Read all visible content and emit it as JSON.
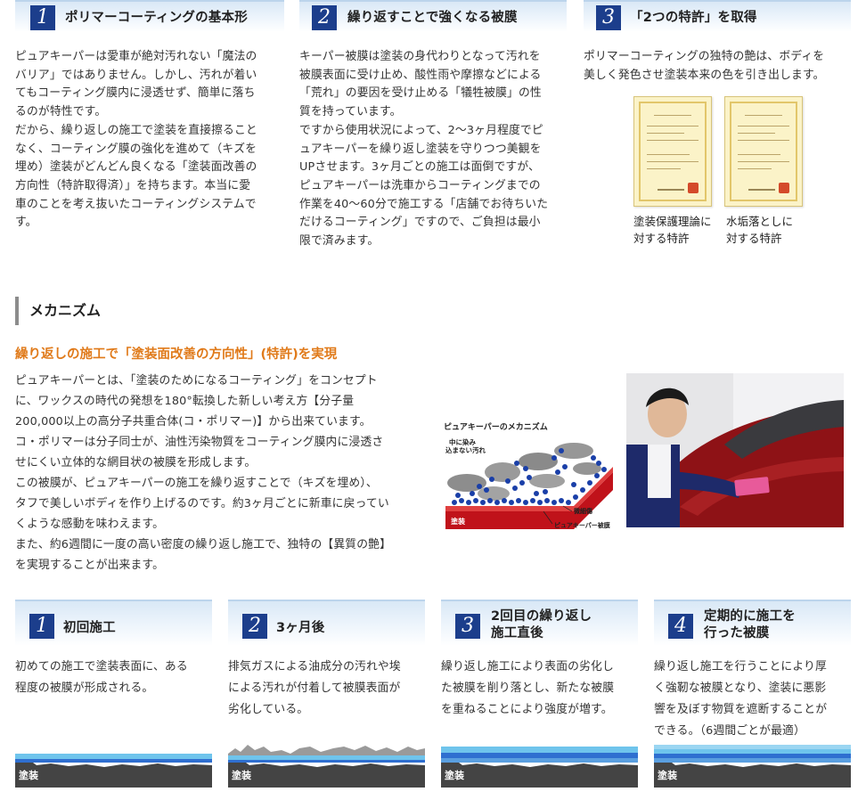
{
  "top_sections": [
    {
      "number": "1",
      "title": "ポリマーコーティングの基本形",
      "lines": [
        "ピュアキーパーは愛車が絶対汚れない「魔法の",
        "バリア」ではありません。しかし、汚れが着い",
        "てもコーティング膜内に浸透せず、簡単に落ち",
        "るのが特性です。",
        "だから、繰り返しの施工で塗装を直接擦ること",
        "なく、コーティング膜の強化を進めて（キズを",
        "埋め）塗装がどんどん良くなる「塗装面改善の",
        "方向性（特許取得済）」を持ちます。本当に愛",
        "車のことを考え抜いたコーティングシステムで",
        "す。"
      ]
    },
    {
      "number": "2",
      "title": "繰り返すことで強くなる被膜",
      "lines": [
        "キーパー被膜は塗装の身代わりとなって汚れを",
        "被膜表面に受け止め、酸性雨や摩擦などによる",
        "「荒れ」の要因を受け止める「犠牲被膜」の性",
        "質を持っています。",
        "ですから使用状況によって、2〜3ヶ月程度でピ",
        "ュアキーパーを繰り返し塗装を守りつつ美観を",
        "UPさせます。3ヶ月ごとの施工は面倒ですが、",
        "ピュアキーパーは洗車からコーティングまでの",
        "作業を40〜60分で施工する「店舗でお待ちいた",
        "だけるコーティング」ですので、ご負担は最小",
        "限で済みます。"
      ]
    },
    {
      "number": "3",
      "title": "「2つの特許」を取得",
      "lines": [
        "ポリマーコーティングの独特の艶は、ボディを",
        "美しく発色させ塗装本来の色を引き出します。"
      ],
      "certificates": [
        {
          "caption_1": "塗装保護理論に",
          "caption_2": "対する特許"
        },
        {
          "caption_1": "水垢落としに",
          "caption_2": "対する特許"
        }
      ]
    }
  ],
  "mechanism": {
    "heading": "メカニズム",
    "subheading": "繰り返しの施工で「塗装面改善の方向性」(特許)を実現",
    "lines": [
      "ピュアキーパーとは、「塗装のためになるコーティング」をコンセプト",
      "に、ワックスの時代の発想を180°転換した新しい考え方【分子量",
      "200,000以上の高分子共重合体(コ・ポリマー)】から出来ています。",
      "コ・ポリマーは分子同士が、油性汚染物質をコーティング膜内に浸透さ",
      "せにくい立体的な網目状の被膜を形成します。",
      "この被膜が、ピュアキーパーの施工を繰り返すことで（キズを埋め）、",
      "タフで美しいボディを作り上げるのです。約3ヶ月ごとに新車に戻ってい",
      "くような感動を味わえます。",
      "また、約6週間に一度の高い密度の繰り返し施工で、独特の【異質の艶】",
      "を実現することが出来ます。"
    ],
    "diagram": {
      "title": "ピュアキーパーのメカニズム",
      "label_dirt_1": "中に染み",
      "label_dirt_2": "込まない汚れ",
      "label_scratch": "微細傷",
      "label_film": "ピュアキーパー被膜",
      "label_paint": "塗装"
    }
  },
  "steps": [
    {
      "number": "1",
      "title_1": "初回施工",
      "title_2": "",
      "lines": [
        "初めての施工で塗装表面に、ある",
        "程度の被膜が形成される。"
      ],
      "layer_label": "塗装"
    },
    {
      "number": "2",
      "title_1": "3ヶ月後",
      "title_2": "",
      "lines": [
        "排気ガスによる油成分の汚れや埃",
        "による汚れが付着して被膜表面が",
        "劣化している。"
      ],
      "layer_label": "塗装"
    },
    {
      "number": "3",
      "title_1": "2回目の繰り返し",
      "title_2": "施工直後",
      "lines": [
        "繰り返し施工により表面の劣化し",
        "た被膜を削り落とし、新たな被膜",
        "を重ねることにより強度が増す。"
      ],
      "layer_label": "塗装"
    },
    {
      "number": "4",
      "title_1": "定期的に施工を",
      "title_2": "行った被膜",
      "lines": [
        "繰り返し施工を行うことにより厚",
        "く強靭な被膜となり、塗装に悪影",
        "響を及ぼす物質を遮断することが",
        "できる。（6週間ごとが最適）"
      ],
      "layer_label": "塗装"
    }
  ]
}
